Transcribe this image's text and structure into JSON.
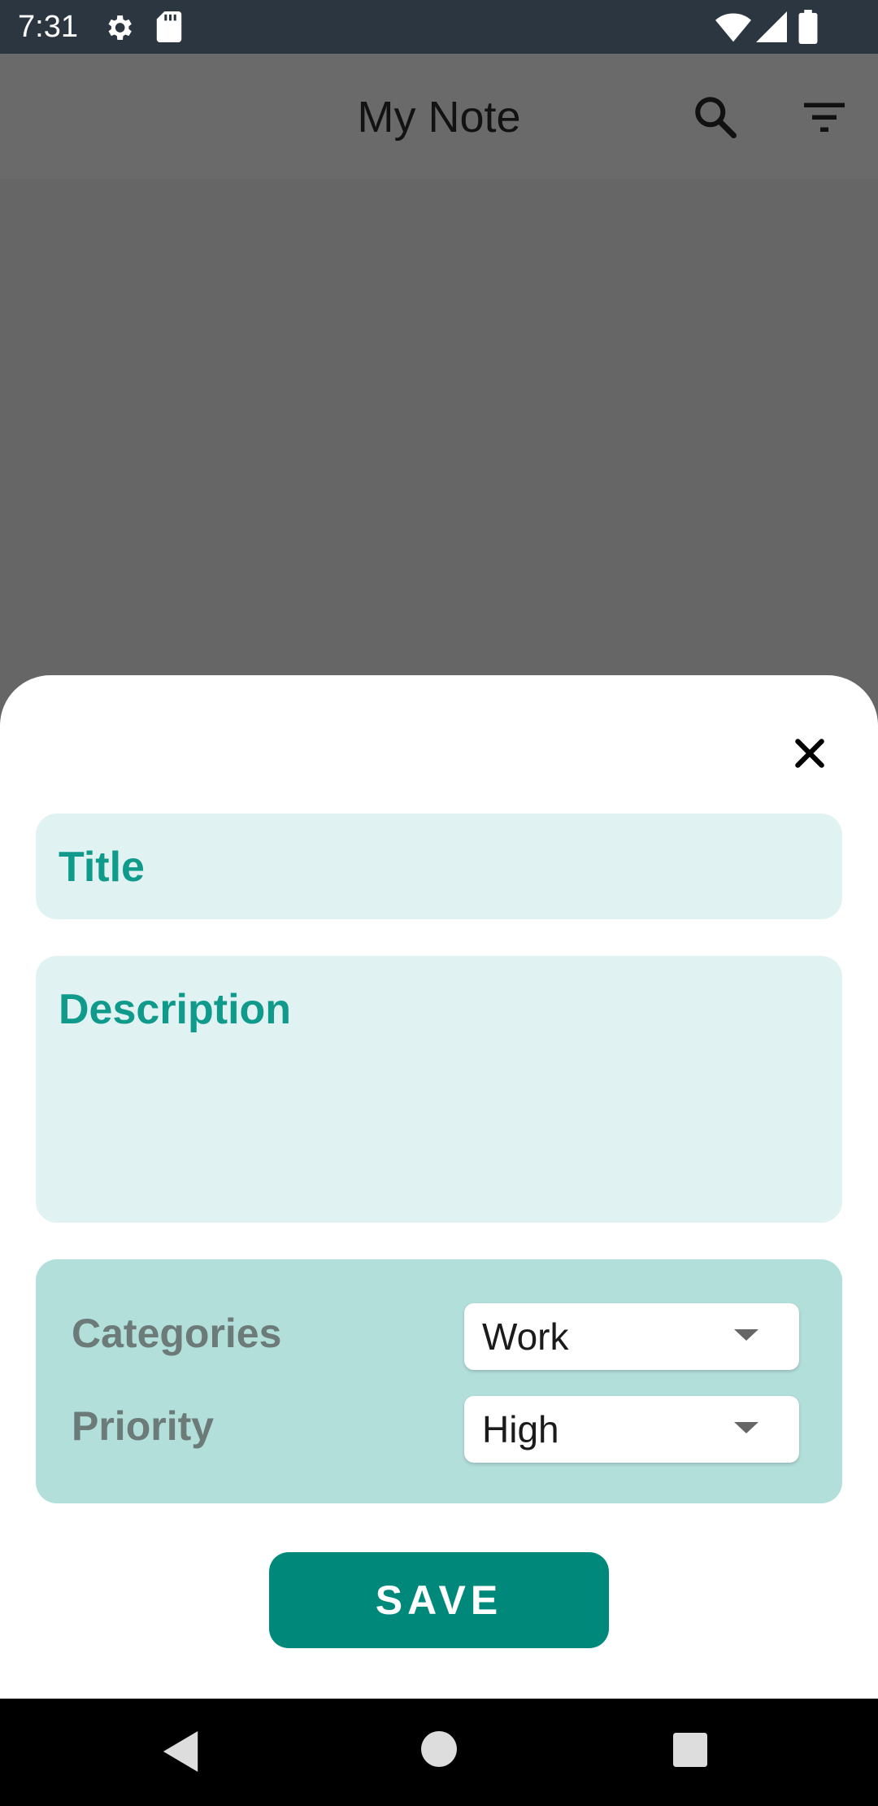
{
  "status_bar": {
    "time": "7:31",
    "icons": [
      "settings-icon",
      "sd-card-icon",
      "wifi-icon",
      "signal-icon",
      "battery-icon"
    ]
  },
  "app_bar": {
    "title": "My Note",
    "actions": [
      "search-icon",
      "filter-icon"
    ]
  },
  "sheet": {
    "close_icon": "close-icon",
    "title_placeholder": "Title",
    "description_placeholder": "Description",
    "categories_label": "Categories",
    "categories_value": "Work",
    "priority_label": "Priority",
    "priority_value": "High",
    "save_label": "SAVE"
  },
  "nav_bar": {
    "buttons": [
      "back-icon",
      "home-icon",
      "recents-icon"
    ]
  },
  "colors": {
    "accent": "#00897b",
    "field_bg": "#e0f2f1",
    "options_bg": "#b3dfdb",
    "label_teal": "#0f9a8b"
  }
}
